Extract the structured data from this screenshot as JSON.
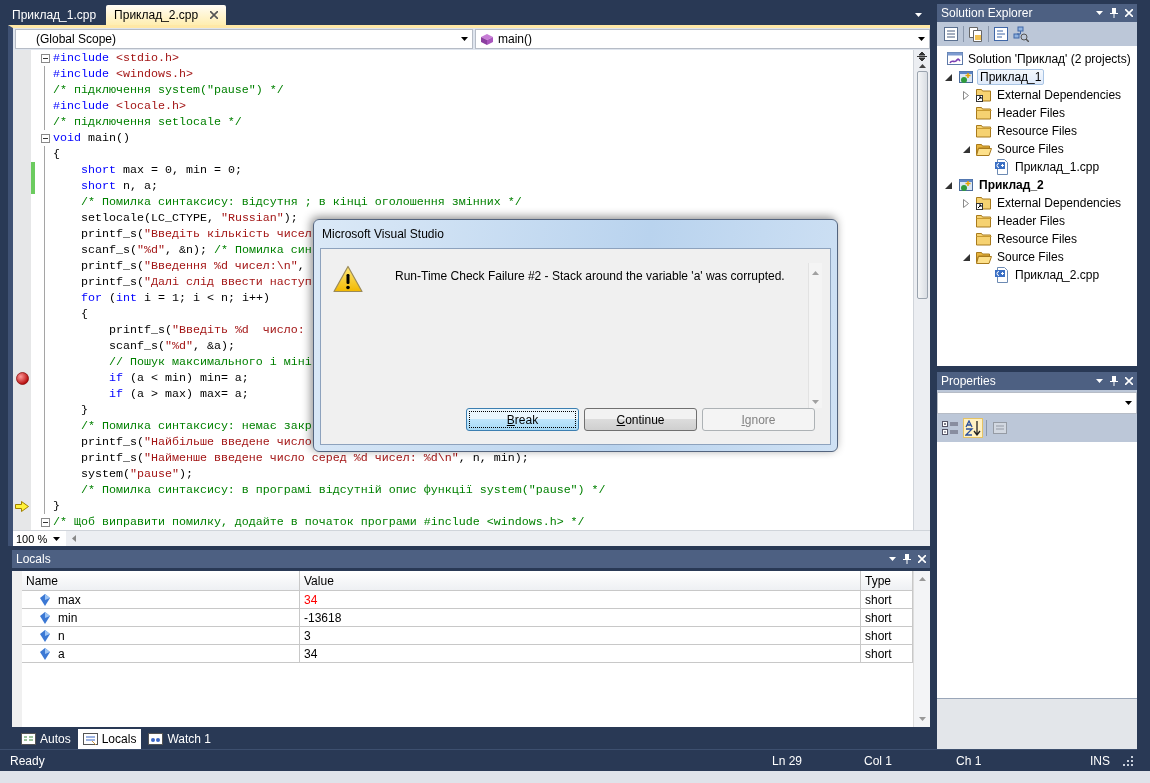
{
  "editor": {
    "tabs": [
      {
        "label": "Приклад_1.cpp",
        "selected": false
      },
      {
        "label": "Приклад_2.cpp",
        "selected": true
      }
    ],
    "scope": "(Global Scope)",
    "member": "main()",
    "zoom": "100 %",
    "lines": [
      {
        "segments": [
          {
            "kind": "kw",
            "text": "#include "
          },
          {
            "kind": "str",
            "text": "<stdio.h>"
          }
        ],
        "fold": true,
        "changed": false,
        "breakpoint": false,
        "current": false
      },
      {
        "segments": [
          {
            "kind": "kw",
            "text": "#include "
          },
          {
            "kind": "str",
            "text": "<windows.h>"
          }
        ],
        "fold": false,
        "changed": false,
        "breakpoint": false,
        "current": false
      },
      {
        "segments": [
          {
            "kind": "cm",
            "text": "/* підключення system(\"pause\") */"
          }
        ],
        "fold": false,
        "changed": false,
        "breakpoint": false,
        "current": false
      },
      {
        "segments": [
          {
            "kind": "kw",
            "text": "#include "
          },
          {
            "kind": "str",
            "text": "<locale.h>"
          }
        ],
        "fold": false,
        "changed": false,
        "breakpoint": false,
        "current": false
      },
      {
        "segments": [
          {
            "kind": "cm",
            "text": "/* підключення setlocale */"
          }
        ],
        "fold": false,
        "changed": false,
        "breakpoint": false,
        "current": false
      },
      {
        "segments": [
          {
            "kind": "kw",
            "text": "void"
          },
          {
            "kind": "pl",
            "text": " main()"
          }
        ],
        "fold": true,
        "changed": false,
        "breakpoint": false,
        "current": false
      },
      {
        "segments": [
          {
            "kind": "pl",
            "text": "{"
          }
        ],
        "fold": false,
        "changed": false,
        "breakpoint": false,
        "current": false
      },
      {
        "segments": [
          {
            "kind": "kw",
            "text": "    short"
          },
          {
            "kind": "pl",
            "text": " max = 0, min = 0;"
          }
        ],
        "fold": false,
        "changed": true,
        "breakpoint": false,
        "current": false
      },
      {
        "segments": [
          {
            "kind": "kw",
            "text": "    short"
          },
          {
            "kind": "pl",
            "text": " n, a;"
          }
        ],
        "fold": false,
        "changed": true,
        "breakpoint": false,
        "current": false
      },
      {
        "segments": [
          {
            "kind": "cm",
            "text": "    /* Помилка синтаксису: відсутня ; в кінці оголошення змінних */"
          }
        ],
        "fold": false,
        "changed": false,
        "breakpoint": false,
        "current": false
      },
      {
        "segments": [
          {
            "kind": "pl",
            "text": "    setlocale(LC_CTYPE, "
          },
          {
            "kind": "str",
            "text": "\"Russian\""
          },
          {
            "kind": "pl",
            "text": ");"
          }
        ],
        "fold": false,
        "changed": false,
        "breakpoint": false,
        "current": false
      },
      {
        "segments": [
          {
            "kind": "pl",
            "text": "    printf_s("
          },
          {
            "kind": "str",
            "text": "\"Введіть кількість чисел"
          }
        ],
        "fold": false,
        "changed": false,
        "breakpoint": false,
        "current": false
      },
      {
        "segments": [
          {
            "kind": "pl",
            "text": "    scanf_s("
          },
          {
            "kind": "str",
            "text": "\"%d\""
          },
          {
            "kind": "pl",
            "text": ", &n); "
          },
          {
            "kind": "cm",
            "text": "/* Помилка син"
          }
        ],
        "fold": false,
        "changed": false,
        "breakpoint": false,
        "current": false
      },
      {
        "segments": [
          {
            "kind": "pl",
            "text": "    printf_s("
          },
          {
            "kind": "str",
            "text": "\"Введення %d чисел:\\n\""
          },
          {
            "kind": "pl",
            "text": ","
          }
        ],
        "fold": false,
        "changed": false,
        "breakpoint": false,
        "current": false
      },
      {
        "segments": [
          {
            "kind": "pl",
            "text": "    printf_s("
          },
          {
            "kind": "str",
            "text": "\"Далі слід ввести наступ"
          }
        ],
        "fold": false,
        "changed": false,
        "breakpoint": false,
        "current": false
      },
      {
        "segments": [
          {
            "kind": "kw",
            "text": "    for"
          },
          {
            "kind": "pl",
            "text": " ("
          },
          {
            "kind": "kw",
            "text": "int"
          },
          {
            "kind": "pl",
            "text": " i = 1; i < n; i++)"
          }
        ],
        "fold": false,
        "changed": false,
        "breakpoint": false,
        "current": false
      },
      {
        "segments": [
          {
            "kind": "pl",
            "text": "    {"
          }
        ],
        "fold": false,
        "changed": false,
        "breakpoint": false,
        "current": false
      },
      {
        "segments": [
          {
            "kind": "pl",
            "text": "        printf_s("
          },
          {
            "kind": "str",
            "text": "\"Введіть %d  число:"
          }
        ],
        "fold": false,
        "changed": false,
        "breakpoint": false,
        "current": false
      },
      {
        "segments": [
          {
            "kind": "pl",
            "text": "        scanf_s("
          },
          {
            "kind": "str",
            "text": "\"%d\""
          },
          {
            "kind": "pl",
            "text": ", &a);"
          }
        ],
        "fold": false,
        "changed": false,
        "breakpoint": false,
        "current": false
      },
      {
        "segments": [
          {
            "kind": "cm",
            "text": "        // Пошук максимального і міні"
          }
        ],
        "fold": false,
        "changed": false,
        "breakpoint": false,
        "current": false
      },
      {
        "segments": [
          {
            "kind": "kw",
            "text": "        if"
          },
          {
            "kind": "pl",
            "text": " (a < min) min= a;"
          }
        ],
        "fold": false,
        "changed": false,
        "breakpoint": true,
        "current": false
      },
      {
        "segments": [
          {
            "kind": "kw",
            "text": "        if"
          },
          {
            "kind": "pl",
            "text": " (a > max) max= a;"
          }
        ],
        "fold": false,
        "changed": false,
        "breakpoint": false,
        "current": false
      },
      {
        "segments": [
          {
            "kind": "pl",
            "text": "    }"
          }
        ],
        "fold": false,
        "changed": false,
        "breakpoint": false,
        "current": false
      },
      {
        "segments": [
          {
            "kind": "cm",
            "text": "    /* Помилка синтаксису: немає закр"
          }
        ],
        "fold": false,
        "changed": false,
        "breakpoint": false,
        "current": false
      },
      {
        "segments": [
          {
            "kind": "pl",
            "text": "    printf_s("
          },
          {
            "kind": "str",
            "text": "\"Найбільше введене число"
          }
        ],
        "fold": false,
        "changed": false,
        "breakpoint": false,
        "current": false
      },
      {
        "segments": [
          {
            "kind": "pl",
            "text": "    printf_s("
          },
          {
            "kind": "str",
            "text": "\"Найменше введене число серед %d чисел: %d\\n\""
          },
          {
            "kind": "pl",
            "text": ", n, min);"
          }
        ],
        "fold": false,
        "changed": false,
        "breakpoint": false,
        "current": false
      },
      {
        "segments": [
          {
            "kind": "pl",
            "text": "    system("
          },
          {
            "kind": "str",
            "text": "\"pause\""
          },
          {
            "kind": "pl",
            "text": ");"
          }
        ],
        "fold": false,
        "changed": false,
        "breakpoint": false,
        "current": false
      },
      {
        "segments": [
          {
            "kind": "cm",
            "text": "    /* Помилка синтаксису: в програмі відсутній опис функції system(\"pause\") */"
          }
        ],
        "fold": false,
        "changed": false,
        "breakpoint": false,
        "current": false
      },
      {
        "segments": [
          {
            "kind": "pl",
            "text": "}"
          }
        ],
        "fold": false,
        "changed": false,
        "breakpoint": false,
        "current": true
      },
      {
        "segments": [
          {
            "kind": "cm",
            "text": "/* Щоб виправити помилку, додайте в початок програми #include <windows.h> */"
          }
        ],
        "fold": true,
        "changed": false,
        "breakpoint": false,
        "current": false
      }
    ]
  },
  "dialog": {
    "title": "Microsoft Visual Studio",
    "message": "Run-Time Check Failure #2 - Stack around the variable 'a' was corrupted.",
    "buttons": [
      {
        "label": "Break",
        "default": true,
        "disabled": false
      },
      {
        "label": "Continue",
        "default": false,
        "disabled": false
      },
      {
        "label": "Ignore",
        "default": false,
        "disabled": true
      }
    ]
  },
  "solution_explorer": {
    "title": "Solution Explorer",
    "tree": [
      {
        "label": "Solution 'Приклад' (2 projects)",
        "kind": "solution",
        "selected": false,
        "children": [
          {
            "label": "Приклад_1",
            "kind": "project",
            "selected": true,
            "startup": false,
            "expanded": true,
            "children": [
              {
                "label": "External Dependencies",
                "kind": "link-folder",
                "selected": false,
                "expanded": false
              },
              {
                "label": "Header Files",
                "kind": "folder",
                "selected": false
              },
              {
                "label": "Resource Files",
                "kind": "folder",
                "selected": false
              },
              {
                "label": "Source Files",
                "kind": "folder",
                "selected": false,
                "expanded": true,
                "children": [
                  {
                    "label": "Приклад_1.cpp",
                    "kind": "file",
                    "selected": false
                  }
                ]
              }
            ]
          },
          {
            "label": "Приклад_2",
            "kind": "project",
            "selected": false,
            "startup": true,
            "expanded": true,
            "children": [
              {
                "label": "External Dependencies",
                "kind": "link-folder",
                "selected": false,
                "expanded": false
              },
              {
                "label": "Header Files",
                "kind": "folder",
                "selected": false
              },
              {
                "label": "Resource Files",
                "kind": "folder",
                "selected": false
              },
              {
                "label": "Source Files",
                "kind": "folder",
                "selected": false,
                "expanded": true,
                "children": [
                  {
                    "label": "Приклад_2.cpp",
                    "kind": "file",
                    "selected": false
                  }
                ]
              }
            ]
          }
        ]
      }
    ]
  },
  "properties": {
    "title": "Properties",
    "toolbar": [
      {
        "kind": "categorized",
        "selected": false,
        "disabled": false
      },
      {
        "kind": "alphabetical",
        "selected": true,
        "disabled": false
      },
      {
        "kind": "property-pages",
        "selected": false,
        "disabled": true
      }
    ]
  },
  "locals": {
    "title": "Locals",
    "columns": [
      "Name",
      "Value",
      "Type"
    ],
    "rows": [
      {
        "name": "max",
        "value": "34",
        "type": "short",
        "changed": true
      },
      {
        "name": "min",
        "value": "-13618",
        "type": "short",
        "changed": false
      },
      {
        "name": "n",
        "value": "3",
        "type": "short",
        "changed": false
      },
      {
        "name": "a",
        "value": "34",
        "type": "short",
        "changed": false
      }
    ],
    "tabs": [
      {
        "label": "Autos",
        "kind": "autos",
        "selected": false
      },
      {
        "label": "Locals",
        "kind": "locals",
        "selected": true
      },
      {
        "label": "Watch 1",
        "kind": "watch",
        "selected": false
      }
    ]
  },
  "status_bar": {
    "message": "Ready",
    "line": "Ln 29",
    "column": "Col 1",
    "char": "Ch 1",
    "mode": "INS"
  }
}
